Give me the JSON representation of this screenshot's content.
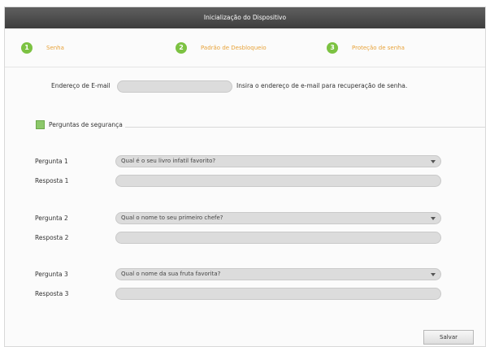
{
  "window": {
    "title": "Inicialização do Dispositivo"
  },
  "colors": {
    "step_accent": "#7cc242",
    "step_label": "#e8a33a",
    "titlebar": "#4a4a4a"
  },
  "steps": [
    {
      "number": "1",
      "label": "Senha"
    },
    {
      "number": "2",
      "label": "Padrão de Desbloqueio"
    },
    {
      "number": "3",
      "label": "Proteção de senha"
    }
  ],
  "email": {
    "label": "Endereço de E-mail",
    "value": "",
    "hint": "Insira o endereço de  e-mail para recuperação de senha."
  },
  "security": {
    "checkbox_label": "Perguntas de segurança",
    "checked": true
  },
  "questions": [
    {
      "question_label": "Pergunta 1",
      "selected": "Qual é o seu livro infatil favorito?",
      "answer_label": "Resposta 1",
      "answer": ""
    },
    {
      "question_label": "Pergunta 2",
      "selected": "Qual o nome to seu primeiro chefe?",
      "answer_label": "Resposta 2",
      "answer": ""
    },
    {
      "question_label": "Pergunta 3",
      "selected": "Qual o nome da sua fruta favorita?",
      "answer_label": "Resposta 3",
      "answer": ""
    }
  ],
  "footer": {
    "save_label": "Salvar"
  }
}
